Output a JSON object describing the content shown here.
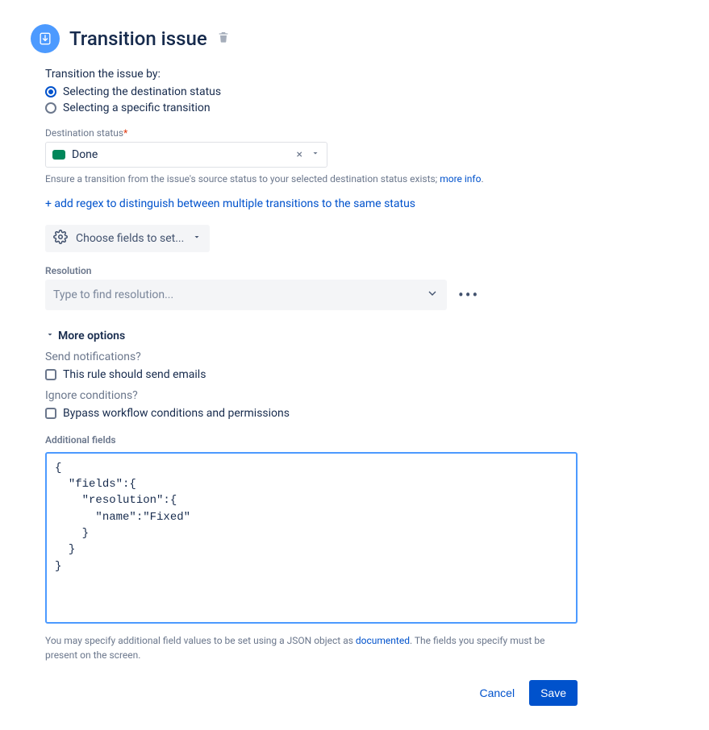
{
  "header": {
    "title": "Transition issue"
  },
  "transition_by": {
    "label": "Transition the issue by:",
    "option_destination": "Selecting the destination status",
    "option_specific": "Selecting a specific transition",
    "selected": "destination"
  },
  "destination_status": {
    "label": "Destination status",
    "value": "Done",
    "help": "Ensure a transition from the issue's source status to your selected destination status exists; ",
    "more_info": "more info",
    "regex_link": "+ add regex to distinguish between multiple transitions to the same status"
  },
  "fields_button": {
    "label": "Choose fields to set..."
  },
  "resolution": {
    "label": "Resolution",
    "placeholder": "Type to find resolution..."
  },
  "more_options": {
    "header": "More options",
    "send_notifications_label": "Send notifications?",
    "send_notifications_checkbox": "This rule should send emails",
    "ignore_conditions_label": "Ignore conditions?",
    "ignore_conditions_checkbox": "Bypass workflow conditions and permissions"
  },
  "additional_fields": {
    "label": "Additional fields",
    "value": "{\n  \"fields\":{\n    \"resolution\":{\n      \"name\":\"Fixed\"\n    }\n  }\n}",
    "note_prefix": "You may specify additional field values to be set using a JSON object as ",
    "note_link": "documented",
    "note_suffix": ". The fields you specify must be present on the screen."
  },
  "buttons": {
    "cancel": "Cancel",
    "save": "Save"
  }
}
